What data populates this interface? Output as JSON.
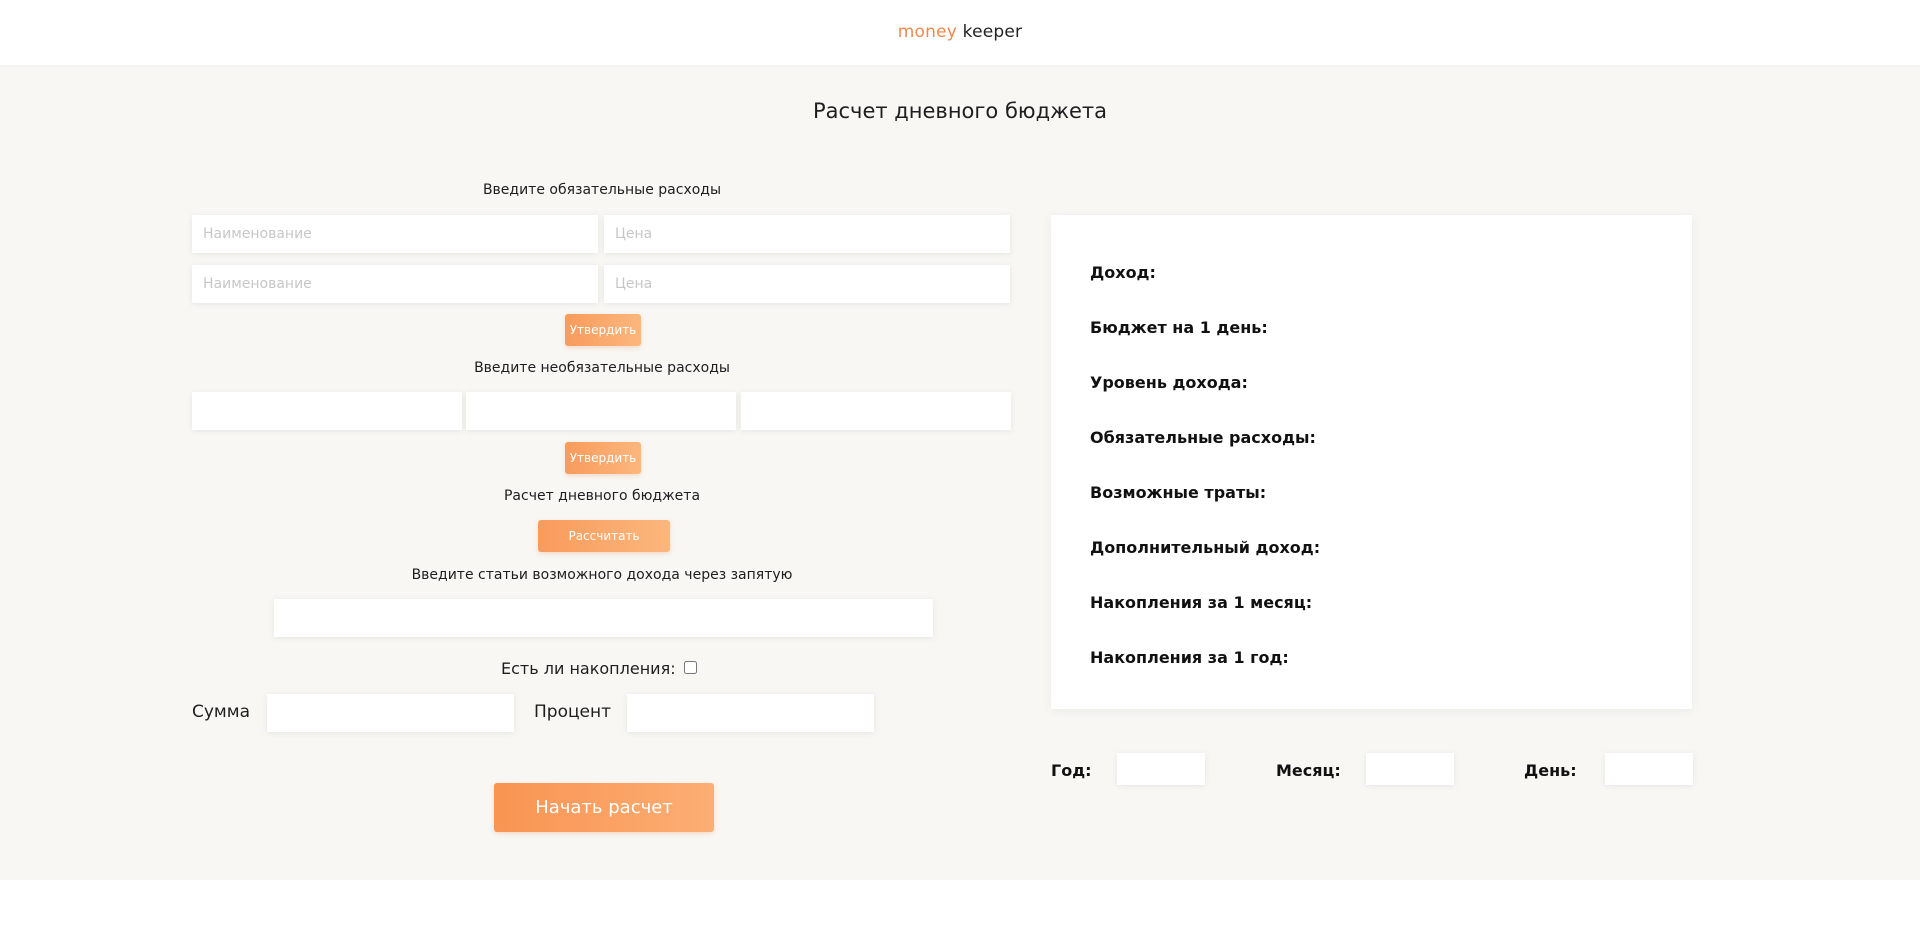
{
  "header": {
    "logo_accent": "money",
    "logo_rest": " keeper",
    "accent_color": "#f08a4b"
  },
  "main": {
    "title": "Расчет дневного бюджета"
  },
  "mandatory": {
    "label": "Введите обязательные расходы",
    "rows": [
      {
        "name_placeholder": "Наименование",
        "price_placeholder": "Цена",
        "name_value": "",
        "price_value": ""
      },
      {
        "name_placeholder": "Наименование",
        "price_placeholder": "Цена",
        "name_value": "",
        "price_value": ""
      }
    ],
    "submit_label": "Утвердить"
  },
  "optional": {
    "label": "Введите необязательные расходы",
    "fields": [
      "",
      "",
      ""
    ],
    "submit_label": "Утвердить"
  },
  "daily": {
    "label": "Расчет дневного бюджета",
    "calc_label": "Рассчитать"
  },
  "income": {
    "label": "Введите статьи возможного дохода через запятую",
    "value": ""
  },
  "savings": {
    "label": "Есть ли накопления:",
    "checked": false,
    "sum_label": "Сумма",
    "sum_value": "",
    "percent_label": "Процент",
    "percent_value": ""
  },
  "start_label": "Начать расчет",
  "results": {
    "items": [
      "Доход:",
      "Бюджет на 1 день:",
      "Уровень дохода:",
      "Обязательные расходы:",
      "Возможные траты:",
      "Дополнительный доход:",
      "Накопления за 1 месяц:",
      "Накопления за 1 год:"
    ]
  },
  "date": {
    "year_label": "Год:",
    "month_label": "Месяц:",
    "day_label": "День:",
    "year_value": "",
    "month_value": "",
    "day_value": ""
  }
}
